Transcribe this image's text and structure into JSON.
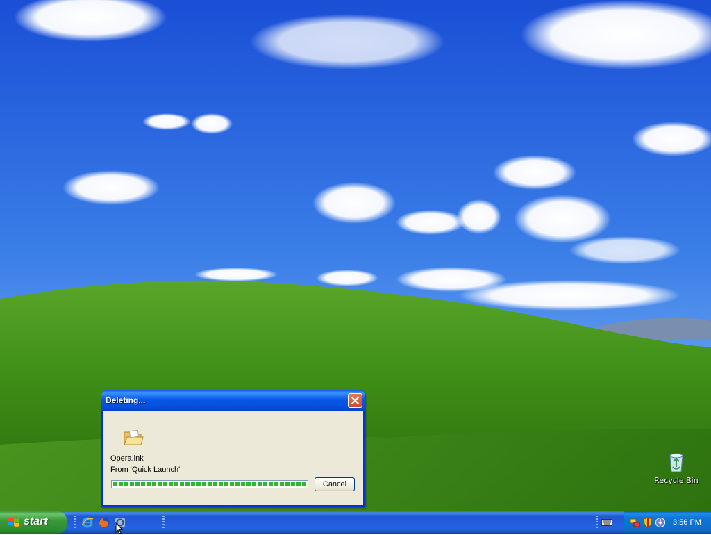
{
  "desktop": {
    "icons": [
      {
        "label": "Recycle Bin"
      }
    ]
  },
  "dialog": {
    "title": "Deleting...",
    "file_name": "Opera.lnk",
    "source": "From 'Quick Launch'",
    "progress_percent": 100,
    "cancel_label": "Cancel",
    "icon": "folder-icon"
  },
  "taskbar": {
    "start_label": "start",
    "quick_launch": [
      {
        "icon": "internet-explorer-icon"
      },
      {
        "icon": "firefox-icon"
      },
      {
        "icon": "opera-icon"
      }
    ],
    "tray": {
      "icons": [
        "network-icon",
        "security-shield-icon",
        "update-icon"
      ],
      "clock": "3:56 PM"
    }
  },
  "colors": {
    "titlebar": "#0a5ee8",
    "dialog_bg": "#ece9d8",
    "progress": "#2fb82f",
    "taskbar": "#2457d6",
    "start": "#3a9a3a"
  }
}
